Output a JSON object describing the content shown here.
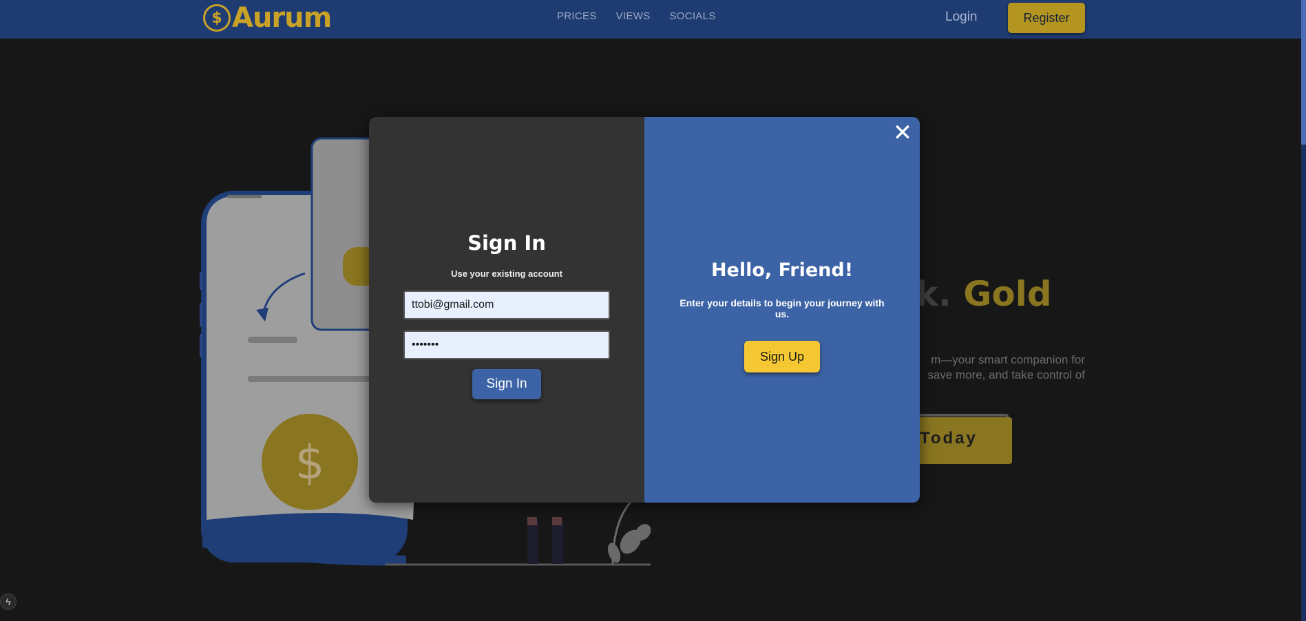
{
  "header": {
    "logo_text": "Aurum",
    "logo_symbol": "$",
    "nav": [
      "PRICES",
      "VIEWS",
      "SOCIALS"
    ],
    "login_label": "Login",
    "register_label": "Register"
  },
  "hero": {
    "heading_visible": "ck.",
    "heading_gold": "Gold",
    "text_line1": "m—your smart companion for",
    "text_line2": "save more, and take control of",
    "cta_label": "Today",
    "coin_symbol": "$"
  },
  "modal": {
    "close_symbol": "✕",
    "signin": {
      "title": "Sign In",
      "subtitle": "Use your existing account",
      "email_value": "ttobi@gmail.com",
      "password_value": "•••••••",
      "button_label": "Sign In"
    },
    "signup": {
      "title": "Hello, Friend!",
      "subtitle": "Enter your details to begin your journey with us.",
      "button_label": "Sign Up"
    }
  },
  "misc": {
    "badge_symbol": "ϟ"
  },
  "colors": {
    "navbar": "#1e3c72",
    "gold": "#c9a227",
    "modal_left": "#333333",
    "modal_right": "#3c63a5",
    "signup_button": "#f5c733"
  }
}
